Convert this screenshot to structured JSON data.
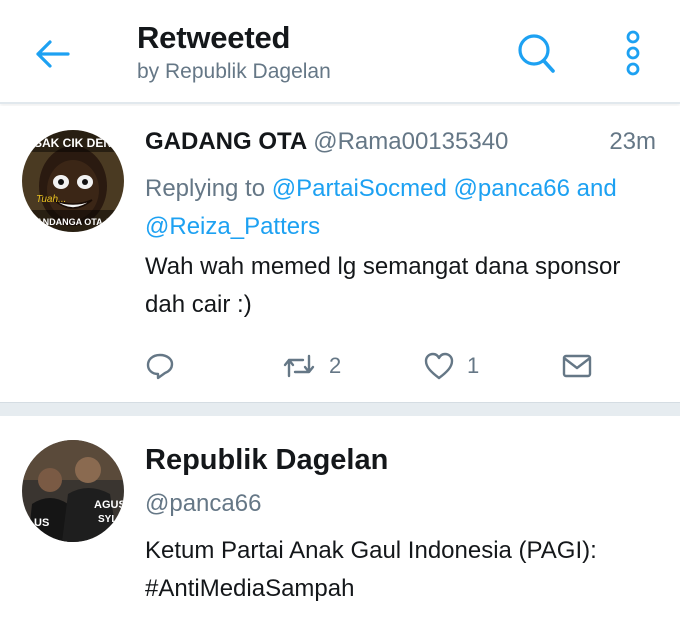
{
  "header": {
    "title": "Retweeted",
    "subtitle": "by Republik Dagelan",
    "back_icon": "arrow-left-icon",
    "search_icon": "search-icon",
    "overflow_icon": "more-vertical-icon",
    "accent_color": "#1da1f2"
  },
  "tweet": {
    "display_name": "GADANG OTA",
    "handle": "@Rama00135340",
    "time": "23m",
    "replying_prefix": "Replying to",
    "mention_1": "@PartaiSocmed",
    "mention_2": "@panca66",
    "and_word": "and",
    "mention_3": "@Reiza_Patters",
    "text": "Wah wah memed lg semangat dana sponsor dah cair :)",
    "avatar_caption_top": "SAK CIK DEN",
    "avatar_caption_mid": "Tuah...",
    "avatar_caption_bottom": "MANDANGA OTA AN",
    "actions": {
      "reply_icon": "reply-icon",
      "retweet_icon": "retweet-icon",
      "retweet_count": "2",
      "like_icon": "heart-icon",
      "like_count": "1",
      "dm_icon": "envelope-icon"
    }
  },
  "profile": {
    "name": "Republik Dagelan",
    "handle": "@panca66",
    "bio": "Ketum Partai Anak Gaul Indonesia (PAGI): #AntiMediaSampah",
    "avatar_text_1": "AGUS",
    "avatar_text_2": "SYL",
    "avatar_text_3": "US"
  }
}
